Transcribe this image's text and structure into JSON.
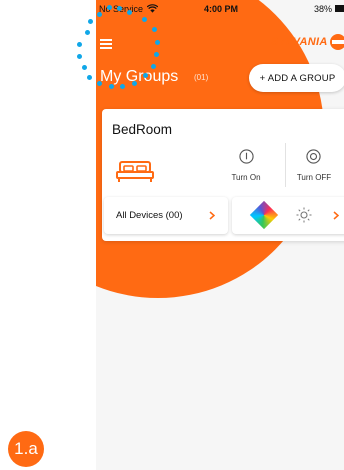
{
  "status_bar": {
    "carrier": "No Service",
    "time": "4:00 PM",
    "battery": "38%"
  },
  "header": {
    "brand": "SYLVANIA",
    "title": "My Groups",
    "group_count": "(01)",
    "add_group_label": "+ ADD A GROUP"
  },
  "group": {
    "name": "BedRoom",
    "turn_on_label": "Turn On",
    "turn_off_label": "Turn OFF",
    "all_devices_label": "All Devices (00)"
  },
  "step_badge": "1.a",
  "colors": {
    "accent": "#ff6a13",
    "annotation": "#10a7e8"
  }
}
